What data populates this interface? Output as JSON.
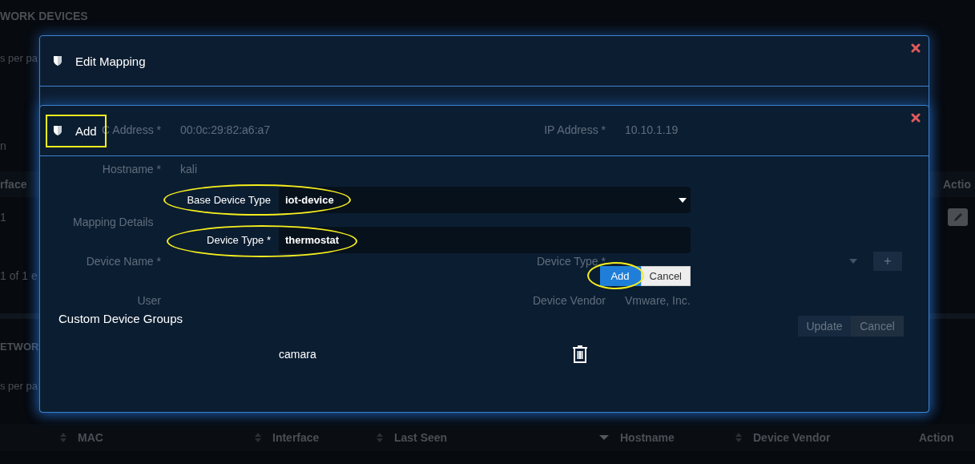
{
  "page": {
    "title": "WORK DEVICES",
    "page_size_text": "s per pa",
    "filter_text": "n",
    "table": {
      "columns": [
        "rface",
        "Actio"
      ],
      "rows": [
        [
          "1"
        ]
      ]
    },
    "info": "1 of 1 e",
    "section_title": "ETWOR",
    "page_size_text_2": "s per pa",
    "table_2": {
      "columns": [
        {
          "label": "MAC",
          "sorted": false
        },
        {
          "label": "Interface",
          "sorted": false
        },
        {
          "label": "Last Seen",
          "sorted": false
        },
        {
          "label": "Hostname",
          "sorted": true
        },
        {
          "label": "Device Vendor",
          "sorted": false
        },
        {
          "label": "Action"
        }
      ]
    }
  },
  "edit_modal": {
    "title": "Edit Mapping",
    "fields": [
      {
        "label": "C Address *",
        "value": "00:0c:29:82:a6:a7"
      },
      {
        "label": "IP Address *",
        "value": "10.10.1.19"
      },
      {
        "label": "Hostname *",
        "value": "kali"
      }
    ],
    "section_title": "Mapping Details",
    "mapping_fields": [
      {
        "label": "Device Name *",
        "kind": "text"
      },
      {
        "label": "Device Type *",
        "kind": "select"
      },
      {
        "label": "User",
        "kind": "text"
      },
      {
        "label": "Device Vendor",
        "kind": "text",
        "value": "Vmware, Inc."
      }
    ],
    "add_button": "+",
    "buttons": [
      "Update",
      "Cancel"
    ]
  },
  "add_modal": {
    "title": "Add",
    "fields": [
      {
        "label": "Base Device Type",
        "kind": "select",
        "value": "iot-device"
      },
      {
        "label": "Device Type *",
        "kind": "input",
        "value": "thermostat"
      }
    ],
    "buttons": [
      {
        "label": "Add",
        "kind": "primary"
      },
      {
        "label": "Cancel",
        "kind": "default"
      }
    ],
    "groups_title": "Custom Device Groups",
    "groups": [
      {
        "name": "camara"
      }
    ]
  }
}
